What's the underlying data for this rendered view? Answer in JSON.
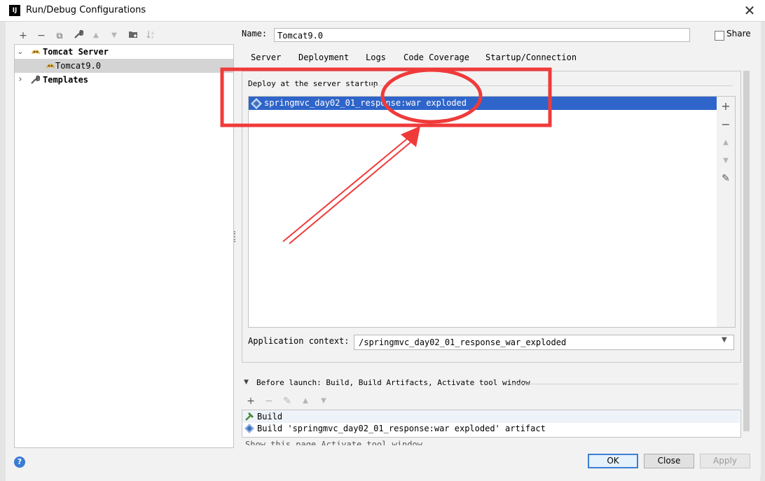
{
  "window": {
    "title": "Run/Debug Configurations",
    "logo_text": "IJ",
    "close_glyph": "✕"
  },
  "left_toolbar": {
    "add": "+",
    "remove": "−",
    "copy": "⧉",
    "edit_defaults": "🔧",
    "move_up": "▲",
    "move_down": "▼",
    "folder": "📁",
    "sort": "↓"
  },
  "tree": {
    "items": [
      {
        "label": "Tomcat Server",
        "icon": "tomcat-icon",
        "expanded": true
      },
      {
        "label": "Tomcat9.0",
        "icon": "tomcat-icon",
        "selected": true
      },
      {
        "label": "Templates",
        "icon": "wrench-icon",
        "expanded": false
      }
    ],
    "expanded_glyph": "⌄",
    "collapsed_glyph": "›"
  },
  "form": {
    "name_label": "Name:",
    "name_value": "Tomcat9.0",
    "share_label": "Share",
    "share_checked": false
  },
  "tabs": [
    "Server",
    "Deployment",
    "Logs",
    "Code Coverage",
    "Startup/Connection"
  ],
  "deployment": {
    "legend": "Deploy at the server startup",
    "items": [
      "springmvc_day02_01_response:war exploded"
    ],
    "side_toolbar": {
      "add": "+",
      "remove": "−",
      "up": "▲",
      "down": "▼",
      "edit": "✎"
    },
    "app_context_label": "Application context:",
    "app_context_value": "/springmvc_day02_01_response_war_exploded"
  },
  "before_launch": {
    "label": "Before launch: Build, Build Artifacts, Activate tool window",
    "toolbar": {
      "add": "+",
      "remove": "−",
      "edit": "✎",
      "up": "▲",
      "down": "▼"
    },
    "items": [
      {
        "label": "Build",
        "icon": "hammer-icon"
      },
      {
        "label": "Build 'springmvc_day02_01_response:war exploded' artifact",
        "icon": "artifact-icon"
      }
    ],
    "cutoff_text": "Show this page  Activate tool window"
  },
  "buttons": {
    "ok": "OK",
    "close": "Close",
    "apply": "Apply",
    "help": "?"
  },
  "colors": {
    "selection": "#2f65ca",
    "annotation": "#f03a3a",
    "ok_border": "#3c7fd6"
  }
}
